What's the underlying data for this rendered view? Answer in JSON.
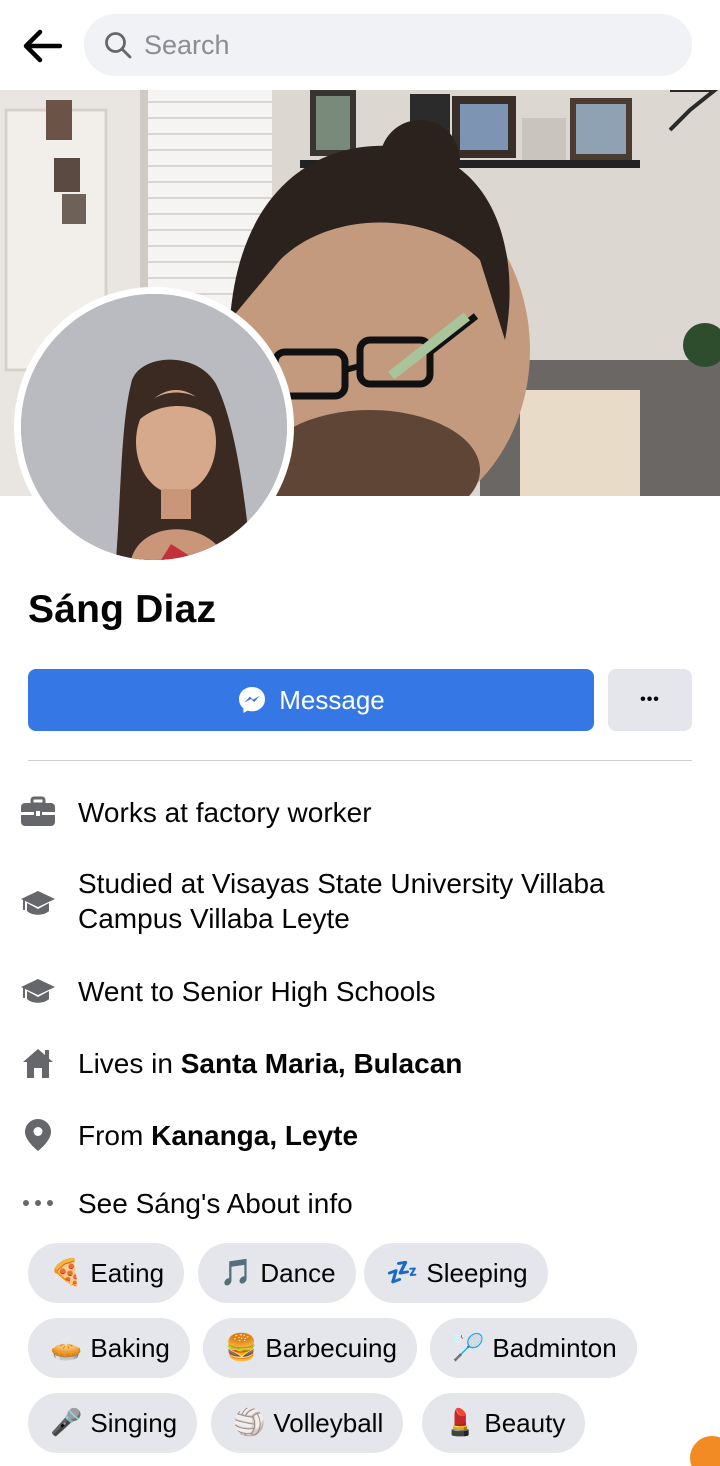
{
  "search": {
    "placeholder": "Search"
  },
  "profile": {
    "name": "Sáng Diaz",
    "message_label": "Message",
    "more_label": "•••"
  },
  "info": [
    {
      "icon": "briefcase-icon",
      "prefix": "Works at factory worker",
      "bold": ""
    },
    {
      "icon": "graduation-cap-icon",
      "prefix": "Studied at Visayas State University Villaba Campus Villaba Leyte",
      "bold": ""
    },
    {
      "icon": "graduation-cap-icon",
      "prefix": "Went to Senior High Schools",
      "bold": ""
    },
    {
      "icon": "home-icon",
      "prefix": "Lives in ",
      "bold": "Santa Maria, Bulacan"
    },
    {
      "icon": "location-pin-icon",
      "prefix": "From ",
      "bold": "Kananga, Leyte"
    },
    {
      "icon": "ellipsis-icon",
      "prefix": "See Sáng's About info",
      "bold": ""
    }
  ],
  "hobbies": [
    {
      "emoji": "🍕",
      "label": "Eating"
    },
    {
      "emoji": "🎵",
      "label": "Dance"
    },
    {
      "emoji": "💤",
      "label": "Sleeping"
    },
    {
      "emoji": "🥧",
      "label": "Baking"
    },
    {
      "emoji": "🍔",
      "label": "Barbecuing"
    },
    {
      "emoji": "🏸",
      "label": "Badminton"
    },
    {
      "emoji": "🎤",
      "label": "Singing"
    },
    {
      "emoji": "🏐",
      "label": "Volleyball"
    },
    {
      "emoji": "💄",
      "label": "Beauty"
    }
  ],
  "colors": {
    "accent": "#3578e5",
    "chip_bg": "#e4e6eb",
    "icon_gray": "#65676b"
  }
}
